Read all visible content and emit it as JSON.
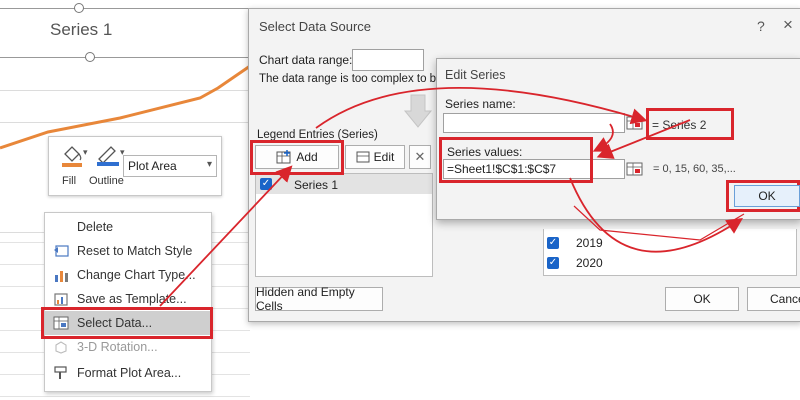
{
  "chart": {
    "title": "Series 1"
  },
  "format_toolbar": {
    "fill_label": "Fill",
    "outline_label": "Outline",
    "element_selected": "Plot Area"
  },
  "context_menu": {
    "items": [
      {
        "label": "Delete",
        "disabled": false
      },
      {
        "label": "Reset to Match Style",
        "disabled": false
      },
      {
        "label": "Change Chart Type...",
        "disabled": false
      },
      {
        "label": "Save as Template...",
        "disabled": false
      },
      {
        "label": "Select Data...",
        "disabled": false
      },
      {
        "label": "3-D Rotation...",
        "disabled": true
      },
      {
        "label": "Format Plot Area...",
        "disabled": false
      }
    ]
  },
  "select_data_source": {
    "title": "Select Data Source",
    "help": "?",
    "close": "×",
    "chart_data_range_label": "Chart data range:",
    "complex_message": "The data range is too complex to be",
    "legend_entries_label": "Legend Entries (Series)",
    "add_label": "Add",
    "edit_label": "Edit",
    "series": [
      "Series 1"
    ],
    "axis_labels": [
      "2019",
      "2020"
    ],
    "hidden_empty_label": "Hidden and Empty Cells",
    "ok_label": "OK",
    "cancel_label": "Cancel"
  },
  "edit_series": {
    "title": "Edit Series",
    "series_name_label": "Series name:",
    "series_name_value": "",
    "series_name_preview": "= Series 2",
    "series_values_label": "Series values:",
    "series_values_value": "=Sheet1!$C$1:$C$7",
    "series_values_preview": "= 0, 15, 60, 35,...",
    "ok_label": "OK"
  },
  "colors": {
    "highlight_red": "#d9252c",
    "series_orange": "#e8873a",
    "checkbox_blue": "#1a64c8"
  }
}
